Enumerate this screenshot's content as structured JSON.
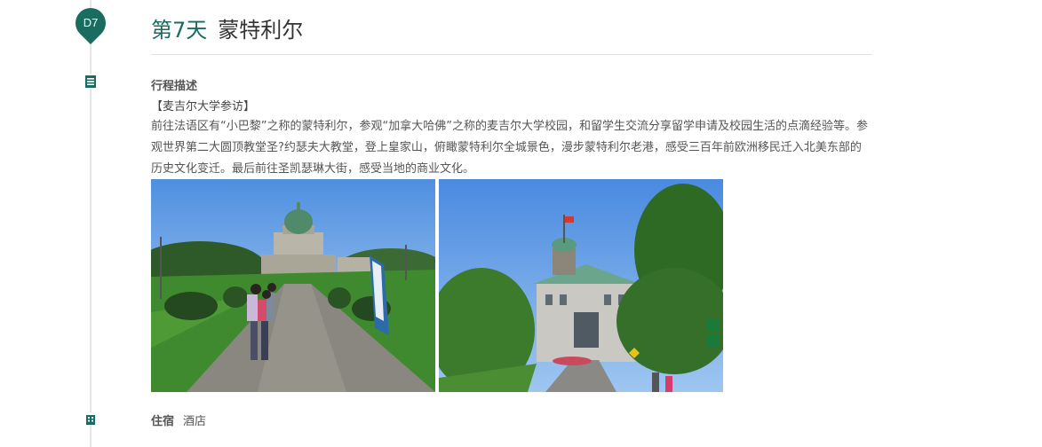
{
  "day": {
    "badge": "D7",
    "label": "第7天",
    "city": "蒙特利尔"
  },
  "itinerary": {
    "section_label": "行程描述",
    "subheading": "【麦吉尔大学参访】",
    "description": "前往法语区有“小巴黎”之称的蒙特利尔，参观“加拿大哈佛”之称的麦吉尔大学校园，和留学生交流分享留学申请及校园生活的点滴经验等。参观世界第二大圆顶教堂圣?约瑟夫大教堂，登上皇家山，俯瞰蒙特利尔全城景色，漫步蒙特利尔老港，感受三百年前欧洲移民迁入北美东部的历史文化变迁。最后前往圣凯瑟琳大街，感受当地的商业文化。"
  },
  "stay": {
    "label": "住宿",
    "value": "酒店"
  },
  "colors": {
    "accent": "#1a6b60",
    "timeline": "#e6e6e6",
    "text": "#555555"
  },
  "icons": {
    "description": "document-list-icon",
    "stay": "building-icon"
  }
}
